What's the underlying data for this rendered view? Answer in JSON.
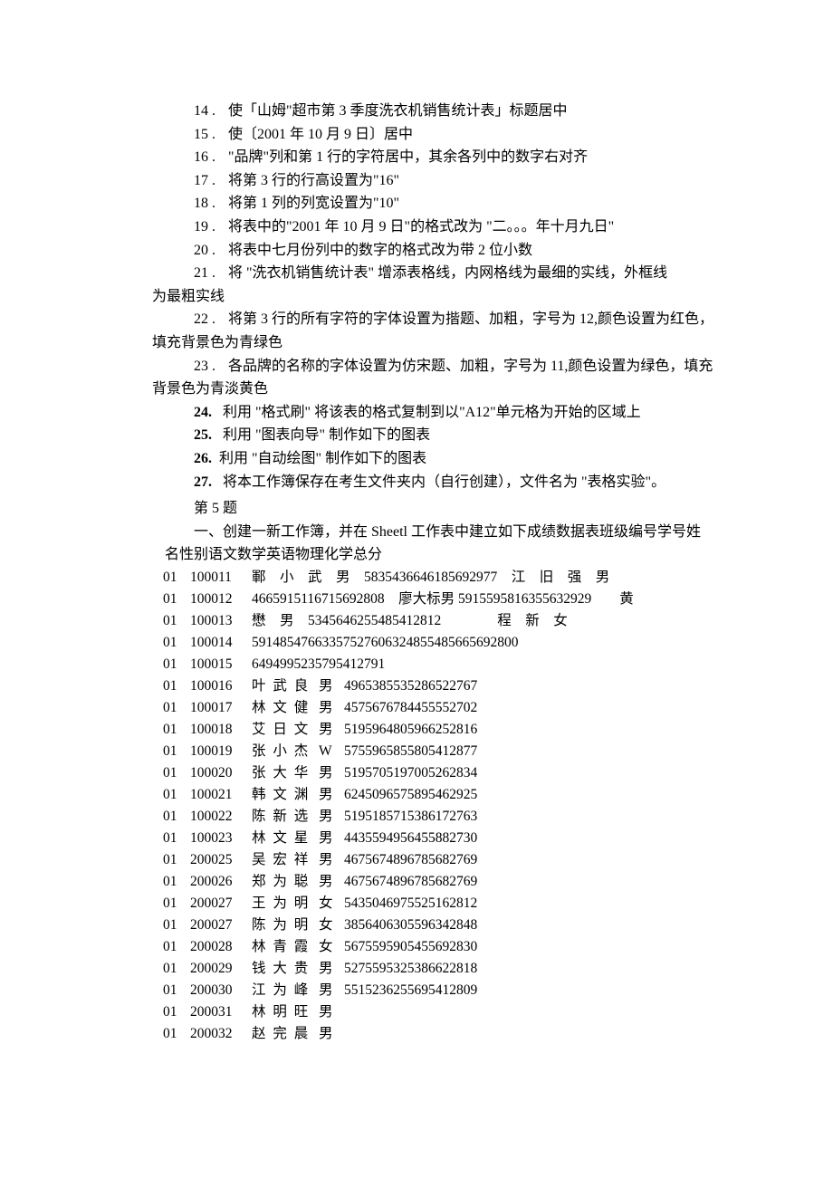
{
  "lines": {
    "l14": {
      "num": "14",
      "dot": ".",
      "text": "使「山姆\"超市第 3 季度洗衣机销售统计表」标题居中"
    },
    "l15": {
      "num": "15",
      "dot": ".",
      "text": "使〔2001 年 10 月 9 日〕居中"
    },
    "l16": {
      "num": "16",
      "dot": ".",
      "text": "\"品牌\"列和第 1 行的字符居中，其余各列中的数字右对齐"
    },
    "l17": {
      "num": "17",
      "dot": ".",
      "text": "将第 3 行的行高设置为\"16\""
    },
    "l18": {
      "num": "18",
      "dot": ".",
      "text": "将第 1 列的列宽设置为\"10\""
    },
    "l19": {
      "num": "19",
      "dot": ".",
      "text": "将表中的\"2001 年 10 月 9 日\"的格式改为 \"二。。。年十月九日\""
    },
    "l20": {
      "num": "20",
      "dot": ".",
      "text": "将表中七月份列中的数字的格式改为带 2 位小数"
    },
    "l21": {
      "num": "21",
      "dot": ".",
      "text": "将 \"洗衣机销售统计表\" 增添表格线，内网格线为最细的实线，外框线",
      "cont": "为最粗实线"
    },
    "l22": {
      "num": "22",
      "dot": ".",
      "text": "将第 3 行的所有字符的字体设置为揩题、加粗，字号为 12,颜色设置为红色，",
      "cont": "填充背景色为青绿色"
    },
    "l23": {
      "num": "23",
      "dot": ".",
      "text": "各品牌的名称的字体设置为仿宋题、加粗，字号为 11,颜色设置为绿色，填充",
      "cont": "背景色为青淡黄色"
    },
    "l24": {
      "num": "24.",
      "text": "利用 \"格式刷\" 将该表的格式复制到以\"A12\"单元格为开始的区域上"
    },
    "l25": {
      "num": "25.",
      "text": "利用 \"图表向导\" 制作如下的图表"
    },
    "l26": {
      "num": "26.",
      "text": "利用 \"自动绘图\" 制作如下的图表"
    },
    "l27": {
      "num": "27.",
      "text": "将本工作簿保存在考生文件夹内（自行创建），文件名为 \"表格实验\"。"
    }
  },
  "section": {
    "title": "第 5 题",
    "intro1": "一、创建一新工作簿，并在 Sheetl 工作表中建立如下成绩数据表班级编号学号姓",
    "intro2": "名性别语文数学英语物理化学总分"
  },
  "rows": [
    {
      "cls": "01",
      "id": "100011",
      "tail": "鄆　小　武　男　5835436646185692977　江　旧　强　男"
    },
    {
      "cls": "01",
      "id": "100012",
      "tail": "4665915116715692808　廖大标男 5915595816355632929　　黄"
    },
    {
      "cls": "01",
      "id": "100013",
      "tail": "懋　男　5345646255485412812　　　　程　新　女"
    },
    {
      "cls": "01",
      "id": "100014",
      "tail": "5914854766335752760632485548566569​2800"
    },
    {
      "cls": "01",
      "id": "100015",
      "tail": "6494995235795412791"
    },
    {
      "cls": "01",
      "id": "100016",
      "name": "叶 武 良",
      "gender": "男",
      "rest": "4965385535286522767"
    },
    {
      "cls": "01",
      "id": "100017",
      "name": "林 文 健",
      "gender": "男",
      "rest": "4575676784455552702"
    },
    {
      "cls": "01",
      "id": "100018",
      "name": "艾 日 文",
      "gender": "男",
      "rest": "5195964805966252816"
    },
    {
      "cls": "01",
      "id": "100019",
      "name": "张 小 杰",
      "gender": "W",
      "rest": "5755965855805412877"
    },
    {
      "cls": "01",
      "id": "100020",
      "name": "张 大 华",
      "gender": "男",
      "rest": "5195705197005262834"
    },
    {
      "cls": "01",
      "id": "100021",
      "name": "韩 文 渊",
      "gender": "男",
      "rest": "6245096575895462925"
    },
    {
      "cls": "01",
      "id": "100022",
      "name": "陈 新 选",
      "gender": "男",
      "rest": "5195185715386172763"
    },
    {
      "cls": "01",
      "id": "100023",
      "name": "林 文 星",
      "gender": "男",
      "rest": "4435594956455882730"
    },
    {
      "cls": "01",
      "id": "200025",
      "name": "吴 宏 祥",
      "gender": "男",
      "rest": "4675674896785682769"
    },
    {
      "cls": "01",
      "id": "200026",
      "name": "郑 为 聪",
      "gender": "男",
      "rest": "4675674896785682769"
    },
    {
      "cls": "01",
      "id": "200027",
      "name": "王 为 明",
      "gender": "女",
      "rest": "5435046975525162812"
    },
    {
      "cls": "01",
      "id": "200027",
      "name": "陈 为 明",
      "gender": "女",
      "rest": "3856406305596342848"
    },
    {
      "cls": "01",
      "id": "200028",
      "name": "林 青 霞",
      "gender": "女",
      "rest": "5675595905455692830"
    },
    {
      "cls": "01",
      "id": "200029",
      "name": "钱 大 贵",
      "gender": "男",
      "rest": "5275595325386622818"
    },
    {
      "cls": "01",
      "id": "200030",
      "name": "江 为 峰",
      "gender": "男",
      "rest": "5515236255695412809"
    },
    {
      "cls": "01",
      "id": "200031",
      "name": "林 明 旺",
      "gender": "男",
      "rest": ""
    },
    {
      "cls": "01",
      "id": "200032",
      "name": "赵 完 晨",
      "gender": "男",
      "rest": ""
    }
  ]
}
